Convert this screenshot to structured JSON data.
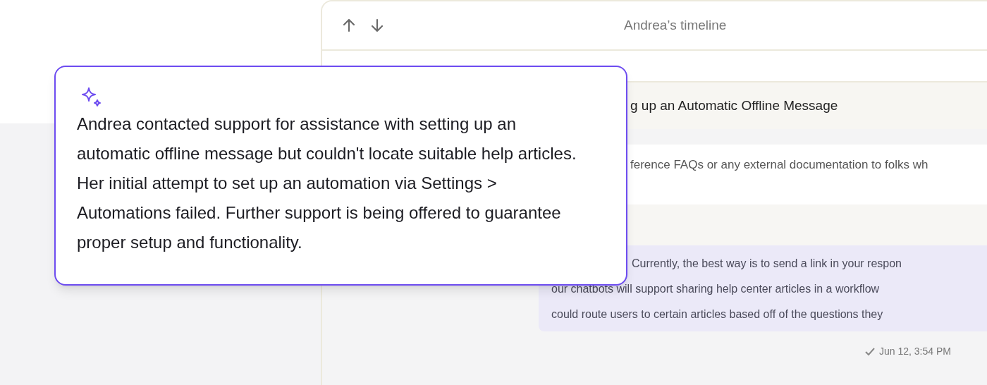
{
  "timeline": {
    "title": "Andrea’s timeline",
    "conversation_title": "g up an Automatic Offline Message",
    "messages": [
      {
        "kind": "user",
        "lines": [
          "ference FAQs or any external documentation to folks wh"
        ]
      },
      {
        "kind": "agent",
        "lines": [
          "Currently, the best way is to send a link in your respon",
          "our chatbots will support sharing help center articles in a workflow",
          "could route users to certain articles based off of the questions they"
        ]
      }
    ],
    "timestamp": "Jun 12, 3:54 PM"
  },
  "summary": {
    "text": "Andrea contacted support for assistance with setting up an automatic offline message but couldn't locate suitable help articles. Her initial attempt to set up an automation via Settings > Automations failed. Further support is being offered to guarantee proper setup and functionality."
  }
}
